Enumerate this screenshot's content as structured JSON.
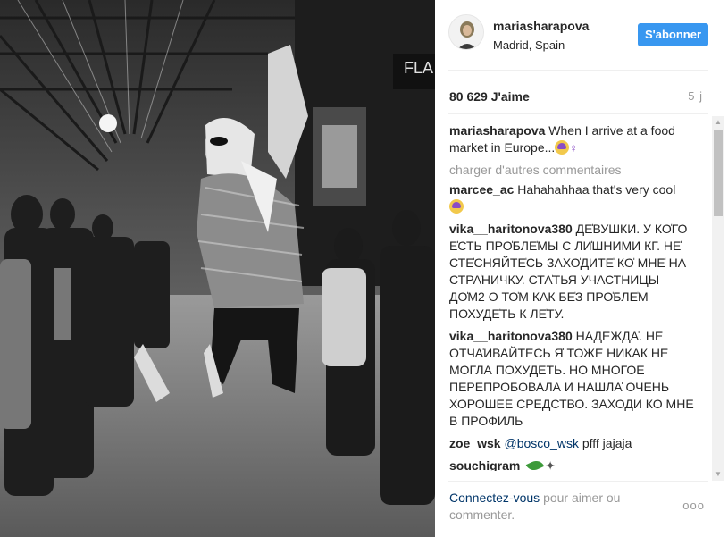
{
  "post": {
    "username": "mariasharapova",
    "location": "Madrid, Spain",
    "follow_label": "S'abonner",
    "likes": "80 629 J'aime",
    "time": "5 j"
  },
  "comments": {
    "caption_user": "mariasharapova",
    "caption_text": "When I arrive at a food market in Europe...",
    "load_more": "charger d'autres commentaires",
    "items": [
      {
        "user": "marcee_ac",
        "text": "Hahahahhaa that's very cool"
      },
      {
        "user": "vika__haritonova380",
        "text": "ДЕ̍ВУШКИ. У КО̍ГО Е̍СТЬ ПРО̍БЛЕ̍МЫ С ЛИ̍ШНИМИ КГ. НЕ̍ СТЕ̍СНЯЙТЕ̍СЬ ЗАХО̍ДИТЕ̍ КО̍ МНЕ̍ НА СТРА̍НИЧКУ. СТА̍ТЬЯ УЧАСТНИЦЫ ДО̍М2 О ТО̍М КА̍К БЕ̍З ПРО̍БЛЕ̍М ПОХУДЕ̍ТЬ К ЛЕ̍ТУ."
      },
      {
        "user": "vika__haritonova380",
        "text": "НАДЕЖДА̍. НЕ ОТЧА̍ИВАЙТЕСЬ Я̍ ТОЖЕ НИКАК НЕ МОГЛА ПОХУДЕТЬ. НО МНОГОЕ ПЕРЕПРОБОВАЛА И НАШЛА̍ ОЧЕНЬ ХОРОШЕЕ СРЕДСТВО. ЗАХОДИ КО МНЕ В ПРОФИЛЬ"
      },
      {
        "user": "zoe_wsk",
        "mention": "@bosco_wsk",
        "text": "pfff jajaja"
      },
      {
        "user": "souchigram",
        "text": ""
      }
    ]
  },
  "footer": {
    "login_link": "Connectez-vous",
    "login_text": "pour aimer ou commenter.",
    "more": "ooo"
  },
  "icons": {
    "caption_emoji": "woman-shrugging-emoji",
    "marcee_emoji": "face-emoji",
    "souchigram_emoji": "leaf-sparkles-emoji"
  },
  "colors": {
    "accent": "#3897f0",
    "link": "#003569",
    "muted": "#999999"
  }
}
